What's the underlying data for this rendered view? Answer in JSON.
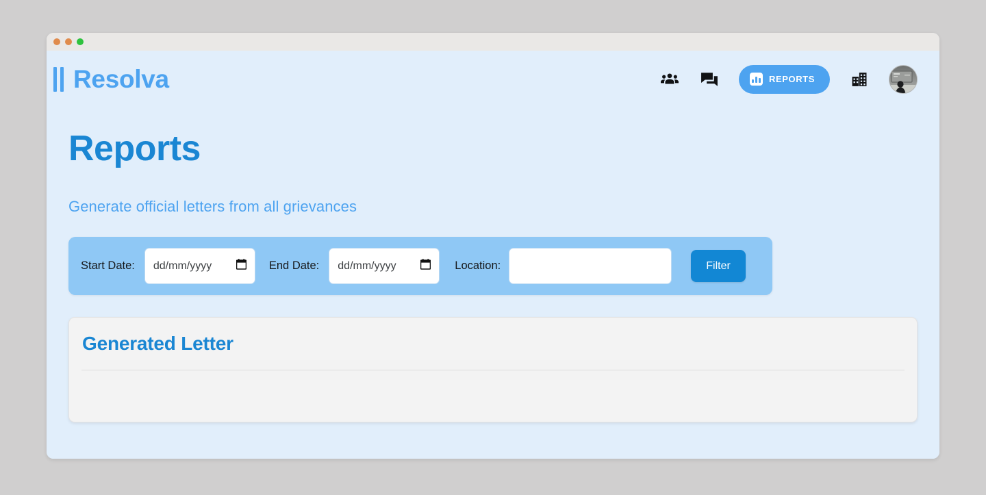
{
  "window": {
    "traffic_lights": [
      {
        "name": "close-dot",
        "color": "#e08b4c"
      },
      {
        "name": "minimize-dot",
        "color": "#e08b4c"
      },
      {
        "name": "maximize-dot",
        "color": "#2ec23f"
      }
    ]
  },
  "navbar": {
    "brand": "Resolva",
    "brand_color": "#4da3f0",
    "icons": [
      {
        "name": "groups-icon",
        "label": "Groups"
      },
      {
        "name": "forum-icon",
        "label": "Messages"
      },
      {
        "name": "domain-icon",
        "label": "Organizations"
      },
      {
        "name": "avatar",
        "label": "Profile"
      }
    ],
    "reports_button": {
      "label": "REPORTS",
      "icon": "bar-chart-icon",
      "background": "#4da3f0",
      "text_color": "#ffffff"
    }
  },
  "page": {
    "title": "Reports",
    "title_color": "#1a86d3",
    "subtitle": "Generate official letters from all grievances",
    "subtitle_color": "#4da3f0"
  },
  "filters": {
    "background": "#8fc8f5",
    "start_date": {
      "label": "Start Date:",
      "value": "",
      "placeholder": "dd/mm/yyyy"
    },
    "end_date": {
      "label": "End Date:",
      "value": "",
      "placeholder": "dd/mm/yyyy"
    },
    "location": {
      "label": "Location:",
      "value": "",
      "placeholder": ""
    },
    "filter_button": {
      "label": "Filter",
      "background": "#1287d4"
    }
  },
  "letter_card": {
    "title": "Generated Letter",
    "title_color": "#1a86d3",
    "body": "",
    "background": "#f3f3f3"
  }
}
